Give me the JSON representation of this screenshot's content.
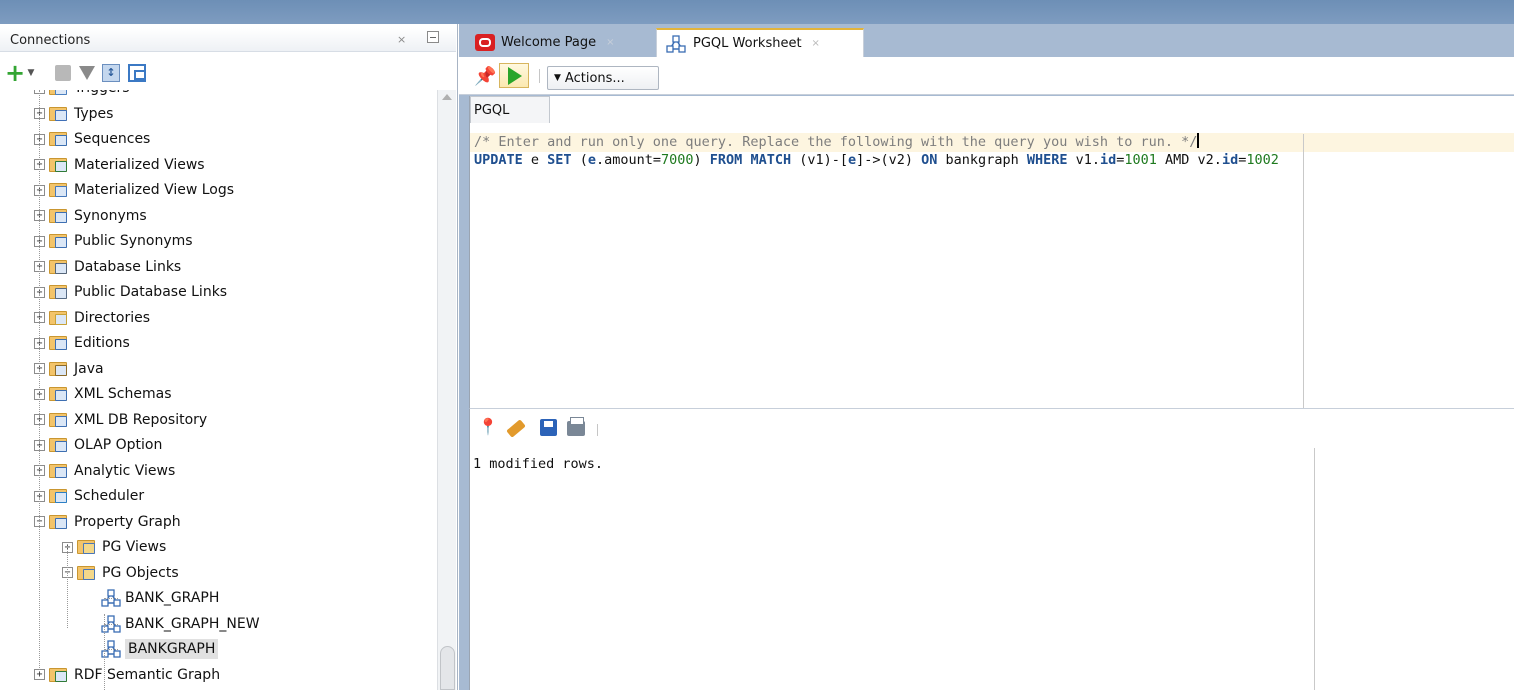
{
  "connections_panel": {
    "title": "Connections",
    "close_glyph": "×",
    "tree_items": [
      {
        "label": "Triggers",
        "expander": "+"
      },
      {
        "label": "Types",
        "expander": "+"
      },
      {
        "label": "Sequences",
        "expander": "+"
      },
      {
        "label": "Materialized Views",
        "expander": "+"
      },
      {
        "label": "Materialized View Logs",
        "expander": "+"
      },
      {
        "label": "Synonyms",
        "expander": "+"
      },
      {
        "label": "Public Synonyms",
        "expander": "+"
      },
      {
        "label": "Database Links",
        "expander": "+"
      },
      {
        "label": "Public Database Links",
        "expander": "+"
      },
      {
        "label": "Directories",
        "expander": "+"
      },
      {
        "label": "Editions",
        "expander": "+"
      },
      {
        "label": "Java",
        "expander": "+"
      },
      {
        "label": "XML Schemas",
        "expander": "+"
      },
      {
        "label": "XML DB Repository",
        "expander": "+"
      },
      {
        "label": "OLAP Option",
        "expander": "+"
      },
      {
        "label": "Analytic Views",
        "expander": "+"
      },
      {
        "label": "Scheduler",
        "expander": "+"
      },
      {
        "label": "Property Graph",
        "expander": "−"
      },
      {
        "label": "PG Views",
        "expander": "+"
      },
      {
        "label": "PG Objects",
        "expander": "−"
      },
      {
        "label": "BANK_GRAPH",
        "expander": ""
      },
      {
        "label": "BANK_GRAPH_NEW",
        "expander": ""
      },
      {
        "label": "BANKGRAPH",
        "expander": ""
      },
      {
        "label": "RDF Semantic Graph",
        "expander": "+"
      }
    ]
  },
  "tabs": [
    {
      "label": "Welcome Page",
      "close": "×"
    },
    {
      "label": "PGQL Worksheet",
      "close": "×"
    }
  ],
  "editor_toolbar": {
    "actions_label": "Actions...",
    "actions_caret": "▼"
  },
  "editor": {
    "tab_label": "PGQL",
    "line1": "/* Enter and run only one query. Replace the following with the query you wish to run. */",
    "line2": {
      "t1": "UPDATE",
      "t2": " e ",
      "t3": "SET",
      "t4": " (",
      "t5": "e",
      "t6": ".amount=",
      "t7": "7000",
      "t8": ") ",
      "t9": "FROM",
      "t10": " ",
      "t11": "MATCH",
      "t12": " (v1)-[",
      "t13": "e",
      "t14": "]->(v2) ",
      "t15": "ON",
      "t16": " bankgraph ",
      "t17": "WHERE",
      "t18": " v1.",
      "t19": "id",
      "t20": "=",
      "t21": "1001",
      "t22": " AMD v2.",
      "t23": "id",
      "t24": "=",
      "t25": "1002"
    }
  },
  "results": {
    "output": "1 modified rows."
  },
  "colors": {
    "header_blue": "#7e9cc0",
    "panel_blue": "#a7bad2",
    "active_tab_accent": "#e2b43c",
    "keyword": "#1f4f8f",
    "number": "#1f7a1f",
    "comment": "#7d7d7d"
  }
}
